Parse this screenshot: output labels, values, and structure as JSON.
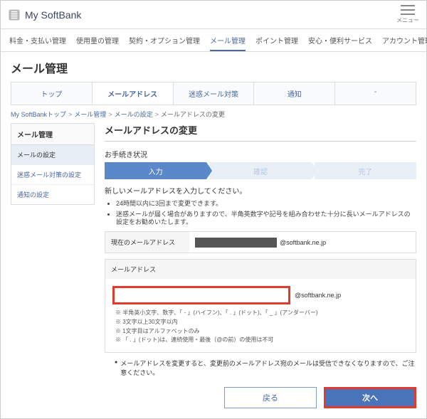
{
  "header": {
    "brand": "My SoftBank",
    "menu_label": "メニュー"
  },
  "topnav": {
    "items": [
      "料金・支払い管理",
      "使用量の管理",
      "契約・オプション管理",
      "メール管理",
      "ポイント管理",
      "安心・便利サービス",
      "アカウント管理"
    ],
    "active_index": 3
  },
  "page_title": "メール管理",
  "tabs": {
    "items": [
      "トップ",
      "メールアドレス",
      "迷惑メール対策",
      "通知",
      "-"
    ],
    "active_index": 1
  },
  "breadcrumbs": {
    "items": [
      "My SoftBankトップ",
      "メール管理",
      "メールの設定"
    ],
    "current": "メールアドレスの変更"
  },
  "sidebar": {
    "title": "メール管理",
    "items": [
      "メールの設定",
      "迷惑メール対策の設定",
      "通知の設定"
    ],
    "selected_index": 0
  },
  "main": {
    "heading": "メールアドレスの変更",
    "status_label": "お手続き状況",
    "steps": [
      "入力",
      "確認",
      "完了"
    ],
    "active_step": 0,
    "lead": "新しいメールアドレスを入力してください。",
    "lead_bullets": [
      "24時間以内に3回まで変更できます。",
      "迷惑メールが届く場合がありますので、半角英数字や記号を組み合わせた十分に長いメールアドレスの設定をお勧めいたします。"
    ],
    "current_row": {
      "label": "現在のメールアドレス",
      "domain": "@softbank.ne.jp"
    },
    "box": {
      "title": "メールアドレス",
      "domain": "@softbank.ne.jp",
      "notes": [
        "半角英小文字、数字、「 - 」(ハイフン)、「 . 」(ドット)、「 _ 」(アンダーバー)",
        "3文字以上30文字以内",
        "1文字目はアルファベットのみ",
        "「 . 」(ドット)は、連続使用・最後（@の前）の使用は不可"
      ]
    },
    "foot_note": "メールアドレスを変更すると、変更前のメールアドレス宛のメールは受信できなくなりますので、ご注意ください。",
    "buttons": {
      "back": "戻る",
      "next": "次へ"
    }
  }
}
